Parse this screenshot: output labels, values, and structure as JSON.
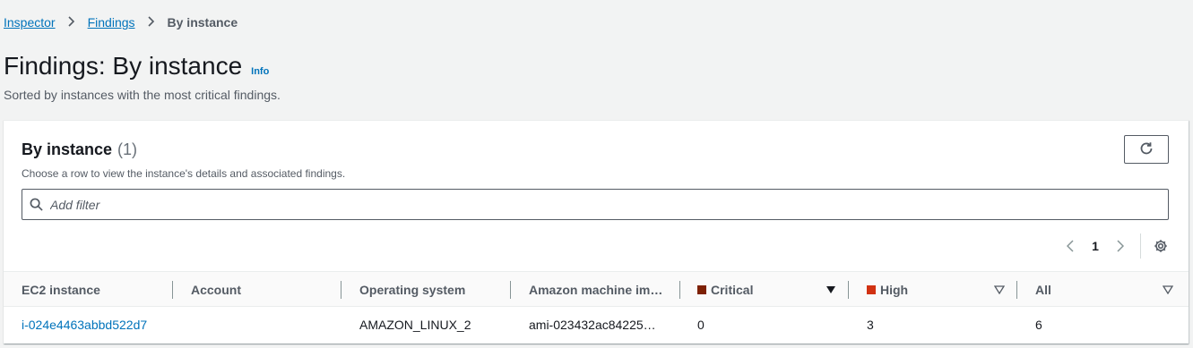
{
  "breadcrumb": {
    "items": [
      "Inspector",
      "Findings"
    ],
    "current": "By instance"
  },
  "page": {
    "title": "Findings: By instance",
    "info_link": "Info",
    "subtitle": "Sorted by instances with the most critical findings."
  },
  "panel": {
    "title": "By instance",
    "count": "(1)",
    "description": "Choose a row to view the instance's details and associated findings.",
    "refresh_icon": "refresh-icon"
  },
  "filter": {
    "placeholder": "Add filter",
    "value": ""
  },
  "pagination": {
    "current_page": "1"
  },
  "table": {
    "columns": [
      "EC2 instance",
      "Account",
      "Operating system",
      "Amazon machine im…",
      "Critical",
      "High",
      "All"
    ],
    "rows": [
      {
        "instance": "i-024e4463abbd522d7",
        "account": "",
        "os": "AMAZON_LINUX_2",
        "ami": "ami-023432ac84225…",
        "critical": "0",
        "high": "3",
        "all": "6"
      }
    ]
  },
  "colors": {
    "link": "#0073bb",
    "critical": "#7d2105",
    "high": "#d13212"
  }
}
